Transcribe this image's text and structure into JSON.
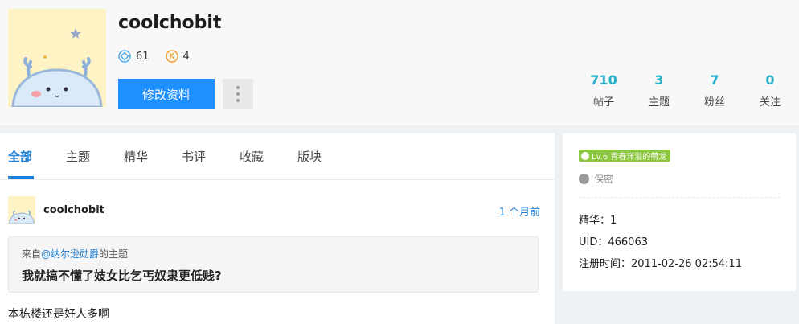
{
  "profile": {
    "username": "coolchobit",
    "badges": [
      {
        "icon": "diamond-icon",
        "value": "61",
        "color": "#4aa8e8"
      },
      {
        "icon": "coin-icon",
        "value": "4",
        "color": "#f0a030"
      }
    ],
    "edit_button": "修改资料",
    "counts": [
      {
        "value": "710",
        "label": "帖子"
      },
      {
        "value": "3",
        "label": "主题"
      },
      {
        "value": "7",
        "label": "粉丝"
      },
      {
        "value": "0",
        "label": "关注"
      }
    ]
  },
  "tabs": [
    "全部",
    "主题",
    "精华",
    "书评",
    "收藏",
    "版块"
  ],
  "active_tab": "全部",
  "post": {
    "username": "coolchobit",
    "time": "1 个月前",
    "quote": {
      "prefix": "来自",
      "author": "@纳尔逊勋爵",
      "suffix": "的主题",
      "title": "我就搞不懂了妓女比乞丐奴隶更低贱?"
    },
    "body": "本栋楼还是好人多啊"
  },
  "sidebar": {
    "level": "Lv.6 青春洋溢的萌龙",
    "privacy": "保密",
    "digest": "精华：1",
    "uid": "UID：466063",
    "register": "注册时间：2011-02-26 02:54:11"
  },
  "colors": {
    "accent": "#1e90ff",
    "count": "#28b0c8",
    "link": "#1e7fd6",
    "level_badge": "#8dc63f"
  }
}
